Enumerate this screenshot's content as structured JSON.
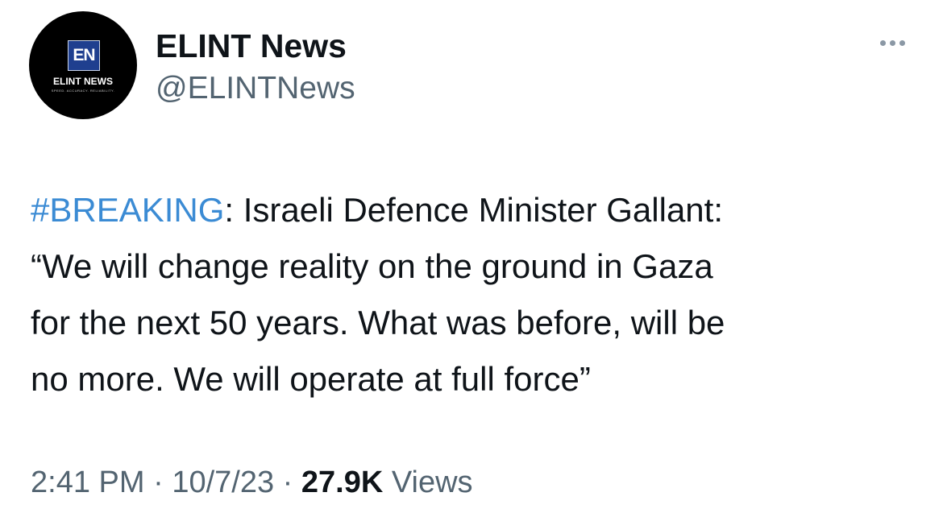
{
  "author": {
    "display_name": "ELINT News",
    "handle": "@ELINTNews",
    "avatar": {
      "logo_initials": "EN",
      "logo_text": "ELINT NEWS",
      "tagline": "SPEED. ACCURACY. RELIABILITY."
    }
  },
  "tweet": {
    "hashtag": "#BREAKING",
    "line1_rest": ": Israeli Defence Minister Gallant:",
    "line2": "“We will change reality on the ground in Gaza",
    "line3": "for the next 50 years. What was before, will be",
    "line4": "no more. We will operate at full force”"
  },
  "meta": {
    "time": "2:41 PM",
    "separator": " · ",
    "date": "10/7/23",
    "views_count": "27.9K",
    "views_label": "Views"
  },
  "icons": {
    "more": "more-horizontal-icon"
  },
  "colors": {
    "hashtag": "#3b8bd4",
    "primary_text": "#0f1419",
    "secondary_text": "#536471",
    "avatar_bg": "#000000",
    "logo_blue": "#1f3f8f"
  }
}
